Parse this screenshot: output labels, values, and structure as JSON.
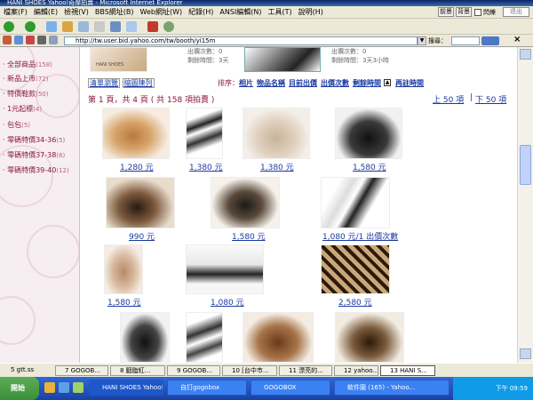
{
  "window": {
    "title": "HANI SHOES Yahoo!奇摩拍賣 - Microsoft Internet Explorer"
  },
  "menu": [
    "檔案(F)",
    "編輯(E)",
    "檢視(V)",
    "BBS網址(B)",
    "Web網址(W)",
    "紀錄(H)",
    "ANSI編輯(N)",
    "工具(T)",
    "說明(H)"
  ],
  "menu_right": {
    "b1": "前景",
    "b2": "背景",
    "chk": "閃爍",
    "sel": "退出"
  },
  "address": {
    "url": "http://tw.user.bid.yahoo.com/tw/booth/yi15m",
    "search_label": "搜尋："
  },
  "sidebar": [
    {
      "label": "全部商品",
      "count": "(158)"
    },
    {
      "label": "新品上市",
      "count": "(72)"
    },
    {
      "label": "特價鞋款",
      "count": "(50)"
    },
    {
      "label": "1元起標",
      "count": "(4)"
    },
    {
      "label": "包包",
      "count": "(5)"
    },
    {
      "label": "零碼特價34-36",
      "count": "(5)"
    },
    {
      "label": "零碼特價37-38",
      "count": "(6)"
    },
    {
      "label": "零碼特價39-40",
      "count": "(12)"
    }
  ],
  "top_items": [
    {
      "bids_label": "出價次數：",
      "bids": "0",
      "time_label": "剩餘時間：",
      "time": "3天"
    },
    {
      "bids_label": "出價次數：",
      "bids": "0",
      "time_label": "剩餘時間：",
      "time": "3天3小時"
    }
  ],
  "view": {
    "list": "清單瀏覽",
    "grid": "縮圖陳列"
  },
  "sort": {
    "label": "排序：",
    "options": [
      "相片",
      "物品名稱",
      "目前出價",
      "出價次數",
      "剩餘時間",
      "再註時間"
    ]
  },
  "paging": {
    "summary": "第 1 頁，共 4 頁 ( 共 158 項拍賣 )",
    "prev": "上 50 項",
    "next": "下 50 項"
  },
  "watermark": "HANI SHOES",
  "products": [
    {
      "price": "1,280 元"
    },
    {
      "price": "1,380 元"
    },
    {
      "price": "1,380 元"
    },
    {
      "price": "1,580 元"
    },
    {
      "price": "990 元"
    },
    {
      "price": "1,580 元"
    },
    {
      "price": "1,080 元/1 出價次數"
    },
    {
      "price": "1,580 元"
    },
    {
      "price": "1,080 元"
    },
    {
      "price": "2,580 元"
    }
  ],
  "taskbar_items": [
    "5 gtt.ss",
    "7 GOGOB...",
    "8 胭脂紅...",
    "9 GOGOB...",
    "10 [台中市...",
    "11 漂亮的...",
    "12 yahoo...",
    "13 HANI S..."
  ],
  "win_buttons": [
    "HANI SHOES Yahoo!...",
    "自訂gogobox",
    "GOGOBOX",
    "軟件園 (165) - Yahoo..."
  ],
  "start_label": "開始",
  "clock": "下午 09:59"
}
